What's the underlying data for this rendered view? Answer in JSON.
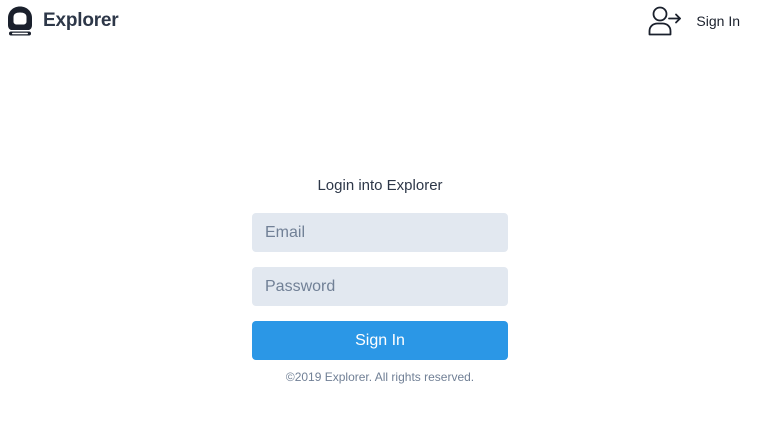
{
  "header": {
    "brand_name": "Explorer",
    "brand_icon": "astronaut-helmet-icon",
    "signin_label": "Sign In",
    "signin_icon": "user-arrow-right-icon"
  },
  "login": {
    "title": "Login into Explorer",
    "email_placeholder": "Email",
    "password_placeholder": "Password",
    "submit_label": "Sign In",
    "copyright": "©2019 Explorer. All rights reserved."
  },
  "colors": {
    "primary": "#2b97e6",
    "input_bg": "#e2e8f0",
    "text_dark": "#2d3748",
    "text_muted": "#718096"
  }
}
